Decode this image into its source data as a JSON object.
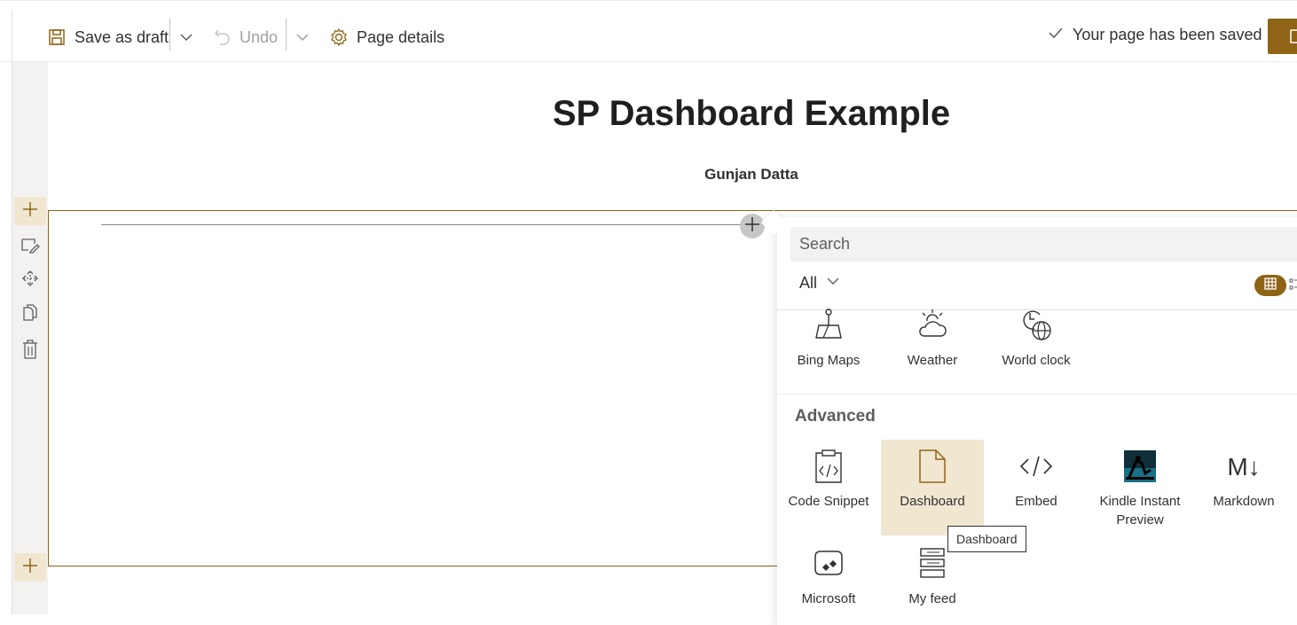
{
  "toolbar": {
    "save_draft": "Save as draft",
    "undo": "Undo",
    "page_details": "Page details",
    "saved_status": "Your page has been saved"
  },
  "page": {
    "title": "SP Dashboard Example",
    "author": "Gunjan Datta"
  },
  "toolbox": {
    "search_placeholder": "Search",
    "filter_label": "All",
    "previous_row": [
      {
        "label": "Bing Maps",
        "icon": "map-icon"
      },
      {
        "label": "Weather",
        "icon": "weather-icon"
      },
      {
        "label": "World clock",
        "icon": "world-clock-icon"
      }
    ],
    "category": "Advanced",
    "advanced": [
      {
        "label": "Code Snippet",
        "icon": "code-snippet-icon"
      },
      {
        "label": "Dashboard",
        "icon": "document-icon"
      },
      {
        "label": "Embed",
        "icon": "embed-icon"
      },
      {
        "label": "Kindle Instant Preview",
        "icon": "kindle-icon"
      },
      {
        "label": "Markdown",
        "icon": "markdown-icon"
      },
      {
        "label": "Microsoft",
        "icon": "power-bi-icon"
      },
      {
        "label": "My feed",
        "icon": "feed-icon"
      }
    ],
    "tooltip": "Dashboard"
  },
  "colors": {
    "accent": "#8f6417",
    "accent_light": "#f1e7d0"
  }
}
